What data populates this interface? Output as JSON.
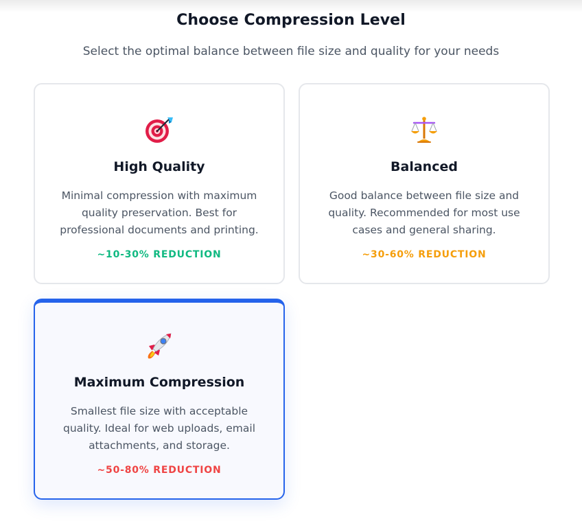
{
  "header": {
    "title": "Choose Compression Level",
    "subtitle": "Select the optimal balance between file size and quality for your needs"
  },
  "options": [
    {
      "icon": "target-icon",
      "title": "High Quality",
      "description": "Minimal compression with maximum quality preservation. Best for professional documents and printing.",
      "reduction": "~10-30% REDUCTION",
      "color": "#10b981",
      "selected": false
    },
    {
      "icon": "balance-scale-icon",
      "title": "Balanced",
      "description": "Good balance between file size and quality. Recommended for most use cases and general sharing.",
      "reduction": "~30-60% REDUCTION",
      "color": "#f59e0b",
      "selected": false
    },
    {
      "icon": "rocket-icon",
      "title": "Maximum Compression",
      "description": "Smallest file size with acceptable quality. Ideal for web uploads, email attachments, and storage.",
      "reduction": "~50-80% REDUCTION",
      "color": "#ef4444",
      "selected": true
    }
  ],
  "accent_color": "#2563eb"
}
